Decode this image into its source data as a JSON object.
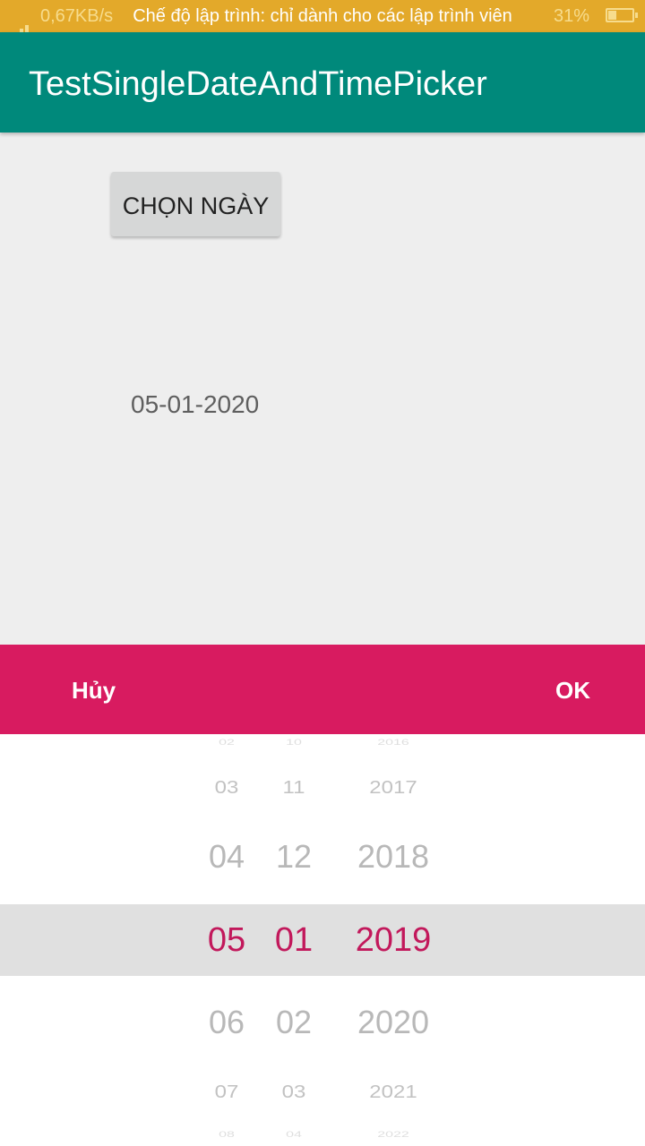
{
  "status_bar": {
    "speed": "0,67KB/s",
    "notice": "Chế độ lập trình: chỉ dành cho các lập trình viên",
    "battery": "31%"
  },
  "app_bar": {
    "title": "TestSingleDateAndTimePicker"
  },
  "main": {
    "choose_button": "CHỌN NGÀY",
    "selected_date": "05-01-2020"
  },
  "picker": {
    "cancel_label": "Hủy",
    "ok_label": "OK",
    "months": [
      "02",
      "03",
      "04",
      "05",
      "06",
      "07",
      "08"
    ],
    "days": [
      "10",
      "11",
      "12",
      "01",
      "02",
      "03",
      "04"
    ],
    "years": [
      "2016",
      "2017",
      "2018",
      "2019",
      "2020",
      "2021",
      "2022"
    ],
    "selected_index": 3
  },
  "colors": {
    "status_bar": "#e3a92a",
    "app_bar": "#00897b",
    "picker_header": "#d81b60",
    "selected_text": "#c2185b",
    "unselected_text": "#b8b8b8"
  }
}
